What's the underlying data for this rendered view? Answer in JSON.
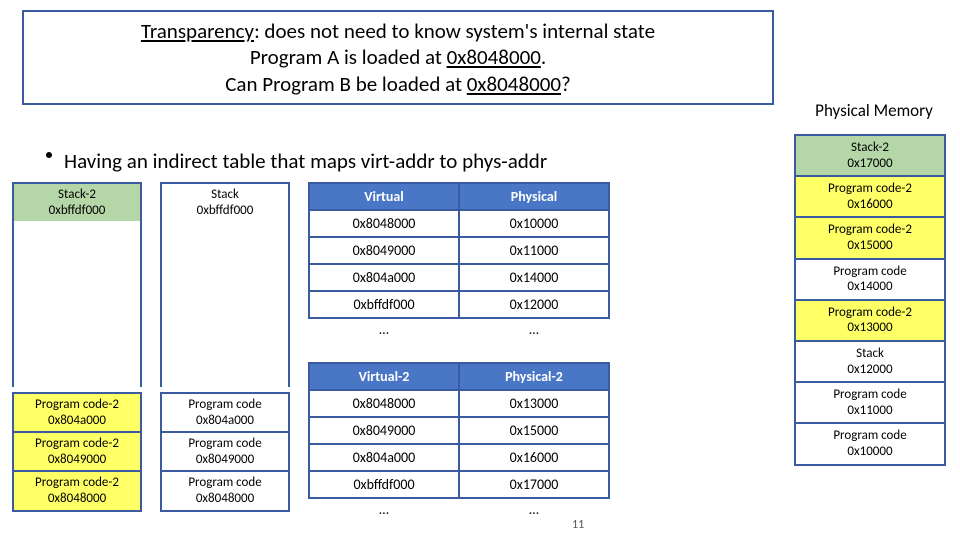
{
  "title": {
    "line1_prefix": "Transparency",
    "line1_rest": ": does not need to know system's internal state",
    "line2_pre": "Program A is loaded at ",
    "line2_addr": "0x8048000",
    "line2_post": ".",
    "line3_pre": "Can Program B be loaded at ",
    "line3_addr": "0x8048000",
    "line3_post": "?"
  },
  "phys_mem_title": "Physical Memory",
  "bullet_text": "Having an indirect table that maps virt-addr to phys-addr",
  "procB_stack": {
    "l1": "Stack-2",
    "l2": "0xbffdf000"
  },
  "procA_stack": {
    "l1": "Stack",
    "l2": "0xbffdf000"
  },
  "procB_code": [
    {
      "l1": "Program code-2",
      "l2": "0x804a000"
    },
    {
      "l1": "Program code-2",
      "l2": "0x8049000"
    },
    {
      "l1": "Program code-2",
      "l2": "0x8048000"
    }
  ],
  "procA_code": [
    {
      "l1": "Program code",
      "l2": "0x804a000"
    },
    {
      "l1": "Program code",
      "l2": "0x8049000"
    },
    {
      "l1": "Program code",
      "l2": "0x8048000"
    }
  ],
  "map1": {
    "hdr_v": "Virtual",
    "hdr_p": "Physical",
    "rows": [
      {
        "v": "0x8048000",
        "p": "0x10000"
      },
      {
        "v": "0x8049000",
        "p": "0x11000"
      },
      {
        "v": "0x804a000",
        "p": "0x14000"
      },
      {
        "v": "0xbffdf000",
        "p": "0x12000"
      }
    ],
    "dots": "…"
  },
  "map2": {
    "hdr_v": "Virtual-2",
    "hdr_p": "Physical-2",
    "rows": [
      {
        "v": "0x8048000",
        "p": "0x13000"
      },
      {
        "v": "0x8049000",
        "p": "0x15000"
      },
      {
        "v": "0x804a000",
        "p": "0x16000"
      },
      {
        "v": "0xbffdf000",
        "p": "0x17000"
      }
    ],
    "dots": "…"
  },
  "phys_col": [
    {
      "l1": "Stack-2",
      "l2": "0x17000",
      "cls": "green"
    },
    {
      "l1": "Program code-2",
      "l2": "0x16000",
      "cls": "yellow"
    },
    {
      "l1": "Program code-2",
      "l2": "0x15000",
      "cls": "yellow"
    },
    {
      "l1": "Program code",
      "l2": "0x14000",
      "cls": ""
    },
    {
      "l1": "Program code-2",
      "l2": "0x13000",
      "cls": "yellow"
    },
    {
      "l1": "Stack",
      "l2": "0x12000",
      "cls": ""
    },
    {
      "l1": "Program code",
      "l2": "0x11000",
      "cls": ""
    },
    {
      "l1": "Program code",
      "l2": "0x10000",
      "cls": ""
    }
  ],
  "page_number": "11"
}
